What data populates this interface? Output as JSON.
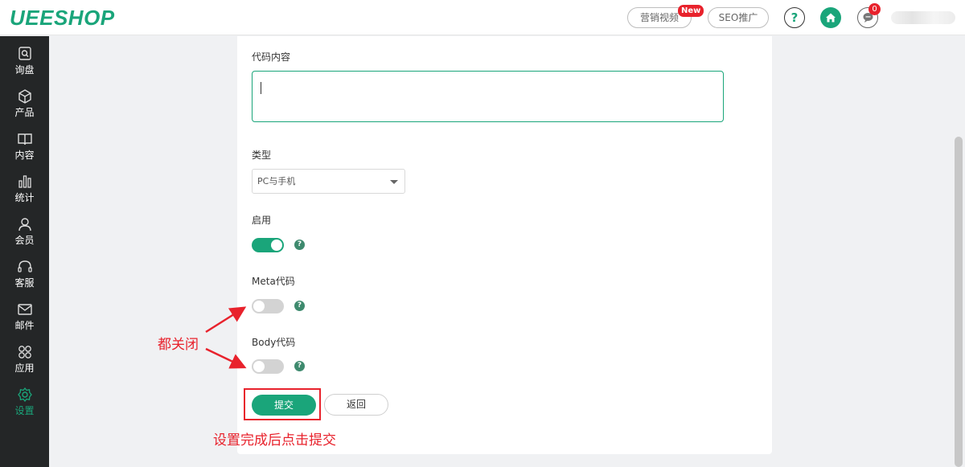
{
  "header": {
    "logo": "UEESHOP",
    "marketing_video": "营销视频",
    "new_badge": "New",
    "seo": "SEO推广",
    "help": "?",
    "message_count": "0"
  },
  "sidebar": {
    "items": [
      {
        "label": "询盘",
        "icon": "inquiry-icon"
      },
      {
        "label": "产品",
        "icon": "cube-icon"
      },
      {
        "label": "内容",
        "icon": "book-icon"
      },
      {
        "label": "统计",
        "icon": "bar-chart-icon"
      },
      {
        "label": "会员",
        "icon": "user-icon"
      },
      {
        "label": "客服",
        "icon": "headset-icon"
      },
      {
        "label": "邮件",
        "icon": "mail-icon"
      },
      {
        "label": "应用",
        "icon": "apps-icon"
      },
      {
        "label": "设置",
        "icon": "gear-icon",
        "active": true
      }
    ]
  },
  "form": {
    "code_content_label": "代码内容",
    "code_content_value": "",
    "type_label": "类型",
    "type_value": "PC与手机",
    "enable_label": "启用",
    "enable_on": true,
    "meta_label": "Meta代码",
    "meta_on": false,
    "body_label": "Body代码",
    "body_on": false,
    "submit": "提交",
    "back": "返回"
  },
  "annotations": {
    "toggles_note": "都关闭",
    "submit_note": "设置完成后点击提交"
  },
  "colors": {
    "accent": "#1aa57a",
    "sidebar_bg": "#242627",
    "annotation_red": "#e8222c"
  }
}
